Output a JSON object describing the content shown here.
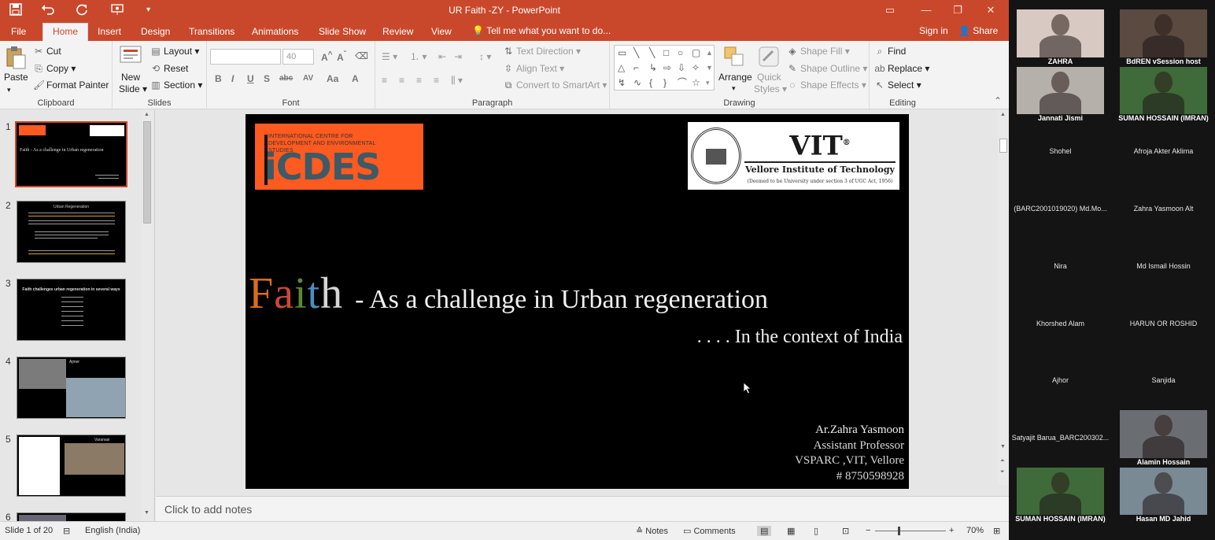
{
  "window": {
    "title": "UR Faith -ZY - PowerPoint"
  },
  "quick_access": {
    "save_icon": "save-icon",
    "undo_icon": "undo-icon",
    "redo_icon": "redo-icon",
    "slideshow_icon": "present-icon"
  },
  "tabs": [
    {
      "label": "File"
    },
    {
      "label": "Home"
    },
    {
      "label": "Insert"
    },
    {
      "label": "Design"
    },
    {
      "label": "Transitions"
    },
    {
      "label": "Animations"
    },
    {
      "label": "Slide Show"
    },
    {
      "label": "Review"
    },
    {
      "label": "View"
    }
  ],
  "tell_me": "Tell me what you want to do...",
  "account": {
    "sign_in": "Sign in",
    "share": "Share"
  },
  "ribbon": {
    "clipboard": {
      "paste": "Paste",
      "cut": "Cut",
      "copy": "Copy",
      "format_painter": "Format Painter",
      "label": "Clipboard"
    },
    "slides": {
      "new_slide": "New",
      "new_slide2": "Slide",
      "layout": "Layout",
      "reset": "Reset",
      "section": "Section",
      "label": "Slides"
    },
    "font": {
      "size": "40",
      "label": "Font",
      "b": "B",
      "i": "I",
      "u": "U",
      "s": "S",
      "abc": "abc",
      "av": "AV",
      "aa": "Aa",
      "a": "A"
    },
    "paragraph": {
      "text_direction": "Text Direction",
      "align_text": "Align Text",
      "convert": "Convert to SmartArt",
      "label": "Paragraph"
    },
    "drawing": {
      "arrange": "Arrange",
      "quick_styles": "Quick",
      "quick_styles2": "Styles",
      "shape_fill": "Shape Fill",
      "shape_outline": "Shape Outline",
      "shape_effects": "Shape Effects",
      "label": "Drawing"
    },
    "editing": {
      "find": "Find",
      "replace": "Replace",
      "select": "Select",
      "label": "Editing"
    }
  },
  "thumbnails": [
    {
      "num": "1",
      "title": "Faith - As a challenge in Urban regeneration"
    },
    {
      "num": "2",
      "title": "Urban Regeneration"
    },
    {
      "num": "3",
      "title": "Faith challenges urban regeneration in several ways"
    },
    {
      "num": "4",
      "title": "Ajmer"
    },
    {
      "num": "5",
      "title": "Varanasi"
    },
    {
      "num": "6",
      "title": ""
    }
  ],
  "slide": {
    "icdes_small": "INTERNATIONAL CENTRE FOR DEVELOPMENT AND ENVIRONMENTAL STUDIES",
    "icdes_big": "iCDES",
    "vit_name": "VIT",
    "vit_reg": "®",
    "vit_full": "Vellore Institute of Technology",
    "vit_deemed": "(Deemed to be University under section 3 of UGC Act, 1956)",
    "title_letters": [
      {
        "ch": "F",
        "color": "#d96d1c"
      },
      {
        "ch": "a",
        "color": "#c94a35"
      },
      {
        "ch": "i",
        "color": "#5a8a35"
      },
      {
        "ch": "t",
        "color": "#4a8fc2"
      },
      {
        "ch": "h",
        "color": "#d6d6d6"
      }
    ],
    "title_rest": " - As a challenge in Urban regeneration",
    "subtitle": ". . . . In the context of India",
    "author_name": "Ar.Zahra Yasmoon",
    "author_role": "Assistant Professor",
    "author_org": "VSPARC ,VIT, Vellore",
    "author_phone": "# 8750598928"
  },
  "notes_placeholder": "Click to add notes",
  "status": {
    "slide_of": "Slide 1 of 20",
    "language": "English (India)",
    "notes": "Notes",
    "comments": "Comments",
    "zoom": "70%"
  },
  "participants": [
    {
      "name": "ZAHRA",
      "video": true,
      "bg": "#d8c9c2"
    },
    {
      "name": "BdREN vSession host",
      "video": true,
      "bg": "#5a4a40"
    },
    {
      "name": "Jannati Jismi",
      "video": true,
      "bg": "#b5b0aa"
    },
    {
      "name": "SUMAN HOSSAIN (IMRAN)",
      "video": true,
      "bg": "#3f6a3a"
    },
    {
      "name": "Shohel",
      "video": false
    },
    {
      "name": "Afroja Akter Aklima",
      "video": false
    },
    {
      "name": "(BARC2001019020) Md.Mo...",
      "video": false
    },
    {
      "name": "Zahra Yasmoon Alt",
      "video": false
    },
    {
      "name": "Nira",
      "video": false
    },
    {
      "name": "Md Ismail Hossin",
      "video": false
    },
    {
      "name": "Khorshed Alam",
      "video": false
    },
    {
      "name": "HARUN OR ROSHID",
      "video": false
    },
    {
      "name": "Ajhor",
      "video": false
    },
    {
      "name": "Sanjida",
      "video": false
    },
    {
      "name": "Satyajit Barua_BARC200302...",
      "video": false
    },
    {
      "name": "Alamin Hossain",
      "video": true,
      "bg": "#6a6e72"
    },
    {
      "name": "SUMAN HOSSAIN (IMRAN)",
      "video": true,
      "bg": "#3f6a3a"
    },
    {
      "name": "Hasan MD Jahid",
      "video": true,
      "bg": "#7a8a95"
    }
  ],
  "colors": {
    "accent": "#c9482b",
    "slide_bg": "#000000",
    "icdes_orange": "#ff5a1f"
  }
}
